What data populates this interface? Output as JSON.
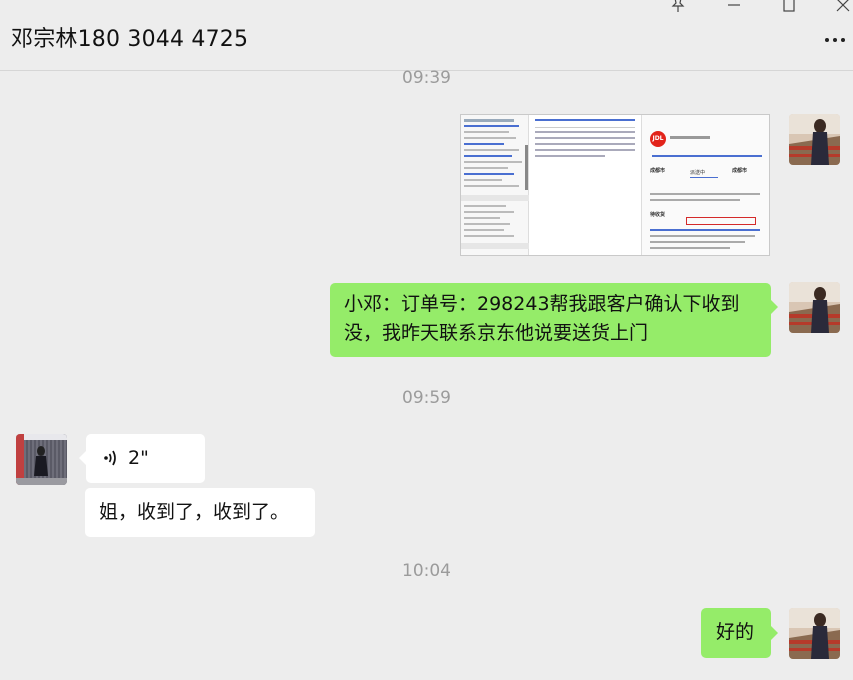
{
  "header": {
    "title": "邓宗林180 3044 4725"
  },
  "window_controls": [
    "pin-icon",
    "minimize-icon",
    "maximize-icon",
    "close-icon"
  ],
  "timestamps": [
    "09:39",
    "09:59",
    "10:04"
  ],
  "messages": {
    "m2": "小邓：订单号：298243帮我跟客户确认下收到没，我昨天联系京东他说要送货上门",
    "voice_duration": "2\"",
    "m4": "姐，收到了，收到了。",
    "m5": "好的"
  },
  "screenshot_thumb": {
    "logo_text": "JDL",
    "city_from": "成都市",
    "city_to": "成都市",
    "status": "派送中",
    "section": "待收货"
  },
  "colors": {
    "background": "#ededed",
    "own_bubble": "#95ec69",
    "other_bubble": "#ffffff",
    "timestamp": "#9b9b9b"
  }
}
